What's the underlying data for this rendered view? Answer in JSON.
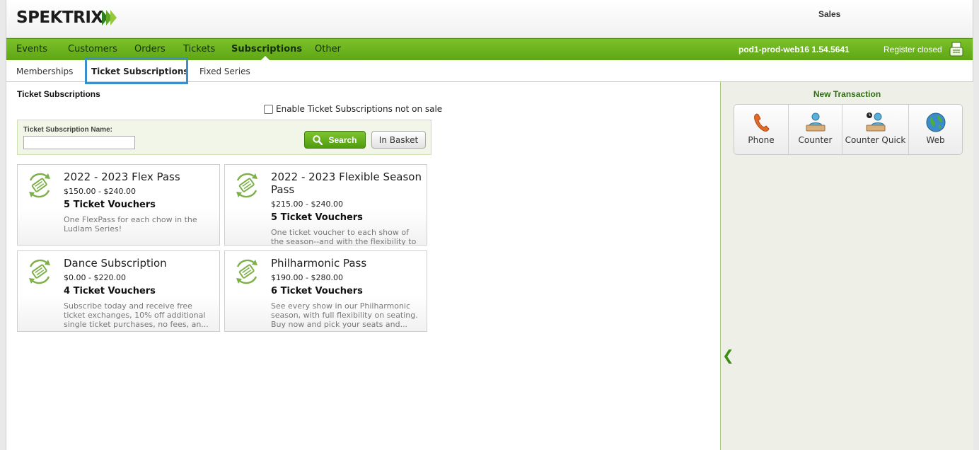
{
  "header": {
    "logo_text": "SPEKTRIX",
    "app_title": "Sales"
  },
  "mainnav": {
    "items": [
      {
        "label": "Events"
      },
      {
        "label": "Customers"
      },
      {
        "label": "Orders"
      },
      {
        "label": "Tickets"
      },
      {
        "label": "Subscriptions",
        "active": true
      },
      {
        "label": "Other"
      }
    ],
    "server": "pod1-prod-web16 1.54.5641",
    "register_status": "Register closed"
  },
  "subnav": {
    "items": [
      {
        "label": "Memberships"
      },
      {
        "label": "Ticket Subscriptions",
        "active": true
      },
      {
        "label": "Fixed Series"
      }
    ]
  },
  "content": {
    "title": "Ticket Subscriptions",
    "enable_label": "Enable Ticket Subscriptions not on sale",
    "enable_checked": false,
    "search": {
      "label": "Ticket Subscription Name:",
      "value": "",
      "search_button": "Search",
      "basket_button": "In Basket"
    },
    "cards": [
      {
        "name": "2022 - 2023 Flex Pass",
        "price": "$150.00 - $240.00",
        "vouchers": "5 Ticket Vouchers",
        "description": "One FlexPass for each chow in the Ludlam Series!"
      },
      {
        "name": "2022 - 2023 Flexible Season Pass",
        "price": "$215.00 - $240.00",
        "vouchers": "5 Ticket Vouchers",
        "description": "One ticket voucher to each show of the season--and with the flexibility to"
      },
      {
        "name": "Dance Subscription",
        "price": "$0.00 - $220.00",
        "vouchers": "4 Ticket Vouchers",
        "description": "Subscribe today and receive free ticket exchanges, 10% off additional single ticket purchases, no fees, an..."
      },
      {
        "name": "Philharmonic Pass",
        "price": "$190.00 - $280.00",
        "vouchers": "6 Ticket Vouchers",
        "description": "See every show in our Philharmonic season, with full flexibility on seating. Buy now and pick your seats and..."
      }
    ]
  },
  "rightpanel": {
    "title": "New Transaction",
    "buttons": [
      {
        "label": "Phone",
        "icon": "phone-icon"
      },
      {
        "label": "Counter",
        "icon": "counter-icon"
      },
      {
        "label": "Counter Quick",
        "icon": "counter-quick-icon"
      },
      {
        "label": "Web",
        "icon": "globe-icon"
      }
    ]
  },
  "colors": {
    "nav_green": "#6db320",
    "accent_blue": "#3d8fca",
    "title_green": "#2e6e10"
  }
}
